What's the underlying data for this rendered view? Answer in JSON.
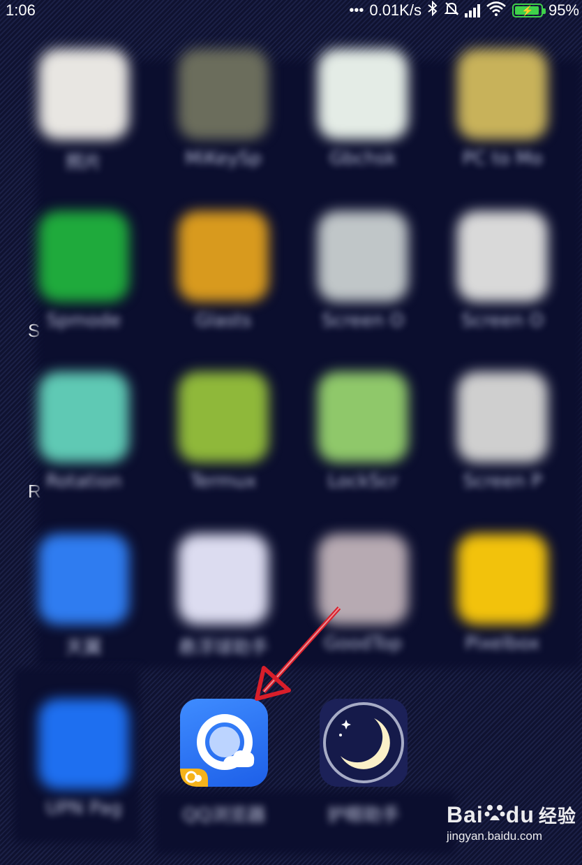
{
  "status_bar": {
    "time": "1:06",
    "dots": "•••",
    "net_speed": "0.01K/s",
    "battery_percent": "95%",
    "icons": [
      "bluetooth-icon",
      "mute-icon",
      "signal-icon",
      "wifi-icon",
      "battery-charging-icon"
    ]
  },
  "background_partial_text": {
    "upper": "S",
    "lower": "R"
  },
  "app_drawer": {
    "blurred": true,
    "apps": [
      {
        "label": "照片",
        "color": "#e8e6e2"
      },
      {
        "label": "MiKeySp",
        "color": "#6b6d5c"
      },
      {
        "label": "Gbchsk",
        "color": "#e4ece6"
      },
      {
        "label": "PC to Mo",
        "color": "#c8b25a"
      },
      {
        "label": "Spmode",
        "color": "#1faa3c"
      },
      {
        "label": "Glasts",
        "color": "#d89a1e"
      },
      {
        "label": "Screen O",
        "color": "#c0c6c8"
      },
      {
        "label": "Screen O",
        "color": "#d9d9d9"
      },
      {
        "label": "Rotation",
        "color": "#5fc9b4"
      },
      {
        "label": "Termux",
        "color": "#8fb83a"
      },
      {
        "label": "LockScr",
        "color": "#8fc86a"
      },
      {
        "label": "Screen P",
        "color": "#cfcfcf"
      },
      {
        "label": "天翼",
        "color": "#2f7cf0"
      },
      {
        "label": "悬浮球助手",
        "color": "#dcdcf0"
      },
      {
        "label": "GoodTop",
        "color": "#b7aab2"
      },
      {
        "label": "Pixelbox",
        "color": "#f2c20c"
      }
    ]
  },
  "dock": {
    "apps": [
      {
        "label": "UPN Pag",
        "color": "#1e6ff0",
        "blurred": true
      },
      {
        "label": "QQ浏览器",
        "icon": "qq-browser-icon",
        "highlighted": true
      },
      {
        "label": "护眼助手",
        "icon": "moon-icon",
        "highlighted": false
      }
    ]
  },
  "annotation": {
    "arrow_color": "#d81e2a",
    "points_to": "qq-browser-icon"
  },
  "watermark": {
    "brand_left": "Bai",
    "brand_right": "du",
    "brand_cn": "经验",
    "url": "jingyan.baidu.com"
  }
}
